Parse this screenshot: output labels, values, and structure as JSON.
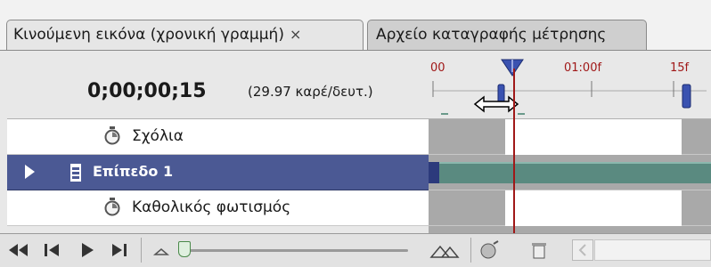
{
  "tabs": [
    {
      "label": "Κινούμενη εικόνα (χρονική γραμμή)",
      "close": "×"
    },
    {
      "label": "Αρχείο καταγραφής μέτρησης"
    }
  ],
  "timecode": "0;00;00;15",
  "fps": "(29.97 καρέ/δευτ.)",
  "ruler_labels": {
    "start": "00",
    "mid": "01:00f",
    "end": "15f"
  },
  "layers": [
    {
      "name": "Σχόλια",
      "icon": "stopwatch-icon"
    },
    {
      "name": "Επίπεδο 1",
      "icon": "film-icon",
      "selected": true
    },
    {
      "name": "Καθολικός φωτισμός",
      "icon": "stopwatch-icon"
    }
  ],
  "colors": {
    "selected_row": "#4b5994",
    "layer_bar": "#5a8a80",
    "playhead": "#a01818",
    "out_of_range": "#a9a9a9"
  },
  "zoom_slider": {
    "value": 0.05
  }
}
